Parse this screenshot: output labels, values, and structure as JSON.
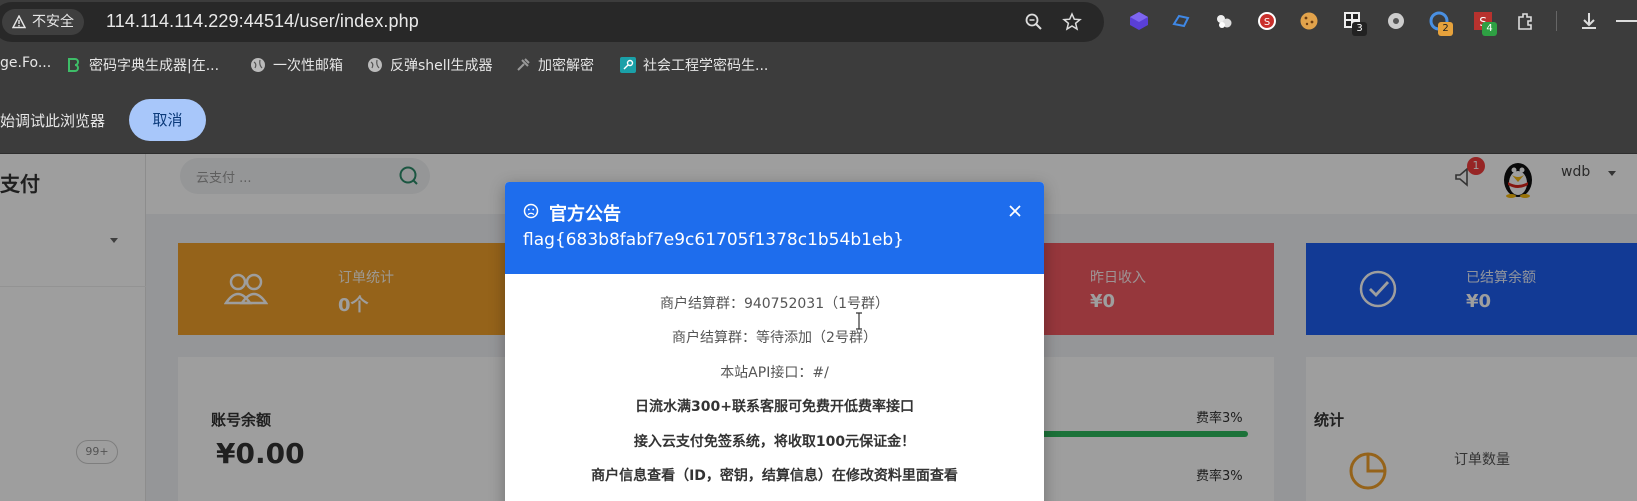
{
  "browser": {
    "security_label": "不安全",
    "url": "114.114.114.229:44514/user/index.php",
    "extension_badges": [
      "3",
      "2",
      "4"
    ]
  },
  "bookmarks": [
    {
      "label": "ge.Fo..."
    },
    {
      "label": "密码字典生成器|在..."
    },
    {
      "label": "一次性邮箱"
    },
    {
      "label": "反弹shell生成器"
    },
    {
      "label": "加密解密"
    },
    {
      "label": "社会工程学密码生..."
    }
  ],
  "infobar": {
    "message": "始调试此浏览器",
    "cancel_label": "取消"
  },
  "sidebar": {
    "brand": "支付",
    "badge": "99+"
  },
  "header": {
    "search_placeholder": "云支付 ...",
    "notification_count": "1",
    "username": "wdb"
  },
  "cards": [
    {
      "title": "订单统计",
      "value": "0个",
      "color": "#f0a02a"
    },
    {
      "title": "昨日收入",
      "value": "¥0",
      "color": "#f35a62"
    },
    {
      "title": "已结算余额",
      "value": "¥0",
      "color": "#1e5ef0"
    }
  ],
  "balance_panel": {
    "title": "账号余额",
    "value": "¥0.00"
  },
  "rates": [
    {
      "label": "费率3%",
      "fill": 1.0
    },
    {
      "label": "费率3%"
    }
  ],
  "stats_panel": {
    "title": "统计",
    "order_count_label": "订单数量"
  },
  "modal": {
    "title": "官方公告",
    "flag": "flag{683b8fabf7e9c61705f1378c1b54b1eb}",
    "lines": [
      "商户结算群：940752031（1号群）",
      "商户结算群：等待添加（2号群）",
      "本站API接口：#/",
      "日流水满300+联系客服可免费开低费率接口",
      "接入云支付免签系统，将收取100元保证金！",
      "商户信息查看（ID，密钥，结算信息）在修改资料里面查看"
    ]
  }
}
